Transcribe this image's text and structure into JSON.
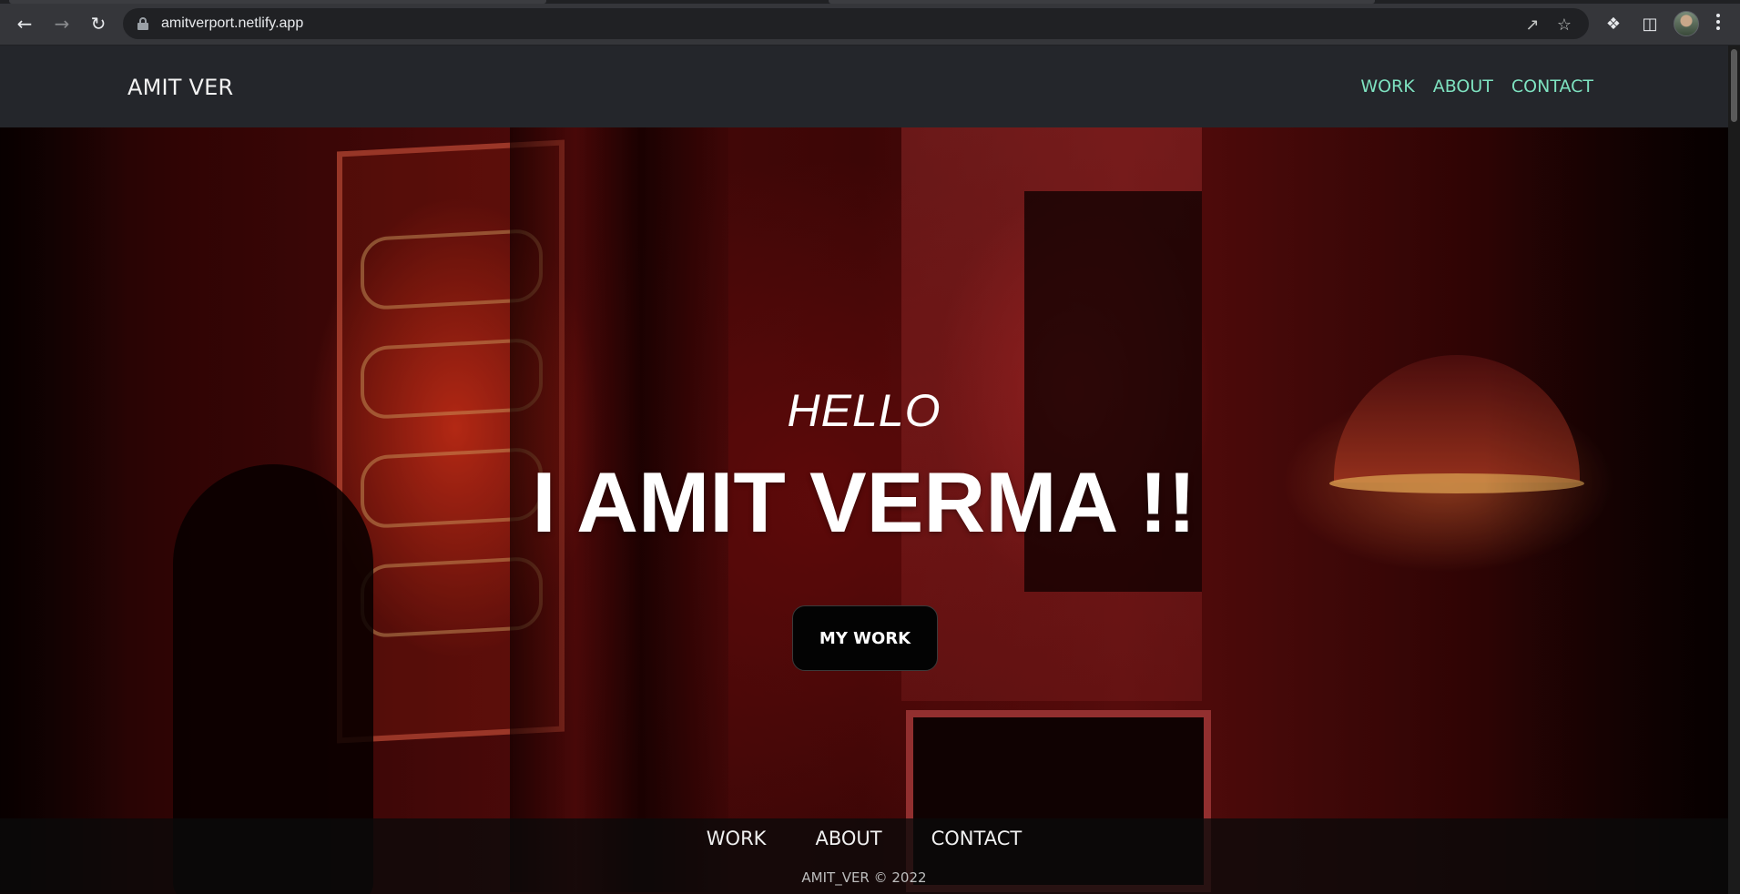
{
  "browser": {
    "url": "amitverport.netlify.app",
    "icons": {
      "back": "arrow-left-icon",
      "forward": "arrow-right-icon",
      "reload": "reload-icon",
      "lock": "lock-icon",
      "share": "share-icon",
      "bookmark": "star-icon",
      "extensions": "puzzle-icon",
      "side_panel": "side-panel-icon",
      "profile": "avatar",
      "menu": "kebab-menu-icon"
    }
  },
  "site": {
    "brand": "AMIT VER",
    "nav": [
      {
        "label": "WORK"
      },
      {
        "label": "ABOUT"
      },
      {
        "label": "CONTACT"
      }
    ],
    "hero": {
      "greeting": "HELLO",
      "headline": "I AMIT VERMA !!",
      "cta_label": "MY WORK"
    },
    "footer": {
      "links": [
        {
          "label": "WORK"
        },
        {
          "label": "ABOUT"
        },
        {
          "label": "CONTACT"
        }
      ],
      "copyright": "AMIT_VER © 2022"
    }
  },
  "colors": {
    "navbar_bg": "#24262b",
    "nav_link": "#7ee2c0",
    "cta_bg": "#030303",
    "hero_tint": "#8a1010"
  }
}
